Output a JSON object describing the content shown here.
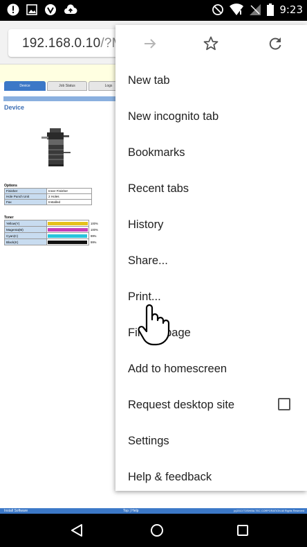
{
  "status_bar": {
    "time": "9:23",
    "left_icons": [
      "alert-icon",
      "image-icon",
      "vpn-icon",
      "cloud-upload-icon"
    ],
    "right_icons": [
      "do-not-disturb-icon",
      "wifi-icon",
      "no-signal-icon",
      "battery-icon"
    ]
  },
  "toolbar": {
    "url_host": "192.168.0.10",
    "url_path": "/?M"
  },
  "web_page": {
    "tabs": [
      "Device",
      "Job Status",
      "Logs"
    ],
    "device_heading": "Device",
    "options_title": "Options",
    "options": [
      {
        "label": "Finisher",
        "value": "Inner Finisher"
      },
      {
        "label": "Hole Punch Unit",
        "value": "2 Holes"
      },
      {
        "label": "Fax",
        "value": "Installed"
      }
    ],
    "toner_title": "Toner",
    "toner": [
      {
        "label": "Yellow(Y)",
        "percent": "100%",
        "level": 100,
        "color": "#e6c11c"
      },
      {
        "label": "Magenta(M)",
        "percent": "100%",
        "level": 100,
        "color": "#c63fb8"
      },
      {
        "label": "Cyan(C)",
        "percent": "99%",
        "level": 99,
        "color": "#28c4dc"
      },
      {
        "label": "Black(K)",
        "percent": "99%",
        "level": 99,
        "color": "#111111"
      }
    ],
    "footer": {
      "left": "Install Software",
      "mid": "Top | Help",
      "right": "(c)2013 TOSHIBA TEC CORPORATION All Rights Reserved"
    }
  },
  "menu": {
    "actions": [
      "forward-icon",
      "bookmark-star-icon",
      "refresh-icon"
    ],
    "items": [
      {
        "label": "New tab"
      },
      {
        "label": "New incognito tab"
      },
      {
        "label": "Bookmarks"
      },
      {
        "label": "Recent tabs"
      },
      {
        "label": "History"
      },
      {
        "label": "Share..."
      },
      {
        "label": "Print..."
      },
      {
        "label": "Find in page"
      },
      {
        "label": "Add to homescreen"
      },
      {
        "label": "Request desktop site"
      },
      {
        "label": "Settings"
      },
      {
        "label": "Help & feedback"
      }
    ]
  },
  "navigation_bar": {
    "buttons": [
      "back-icon",
      "home-icon",
      "recents-icon"
    ]
  },
  "colors": {
    "accent_blue": "#3c78c7",
    "status_bar": "#000000"
  }
}
